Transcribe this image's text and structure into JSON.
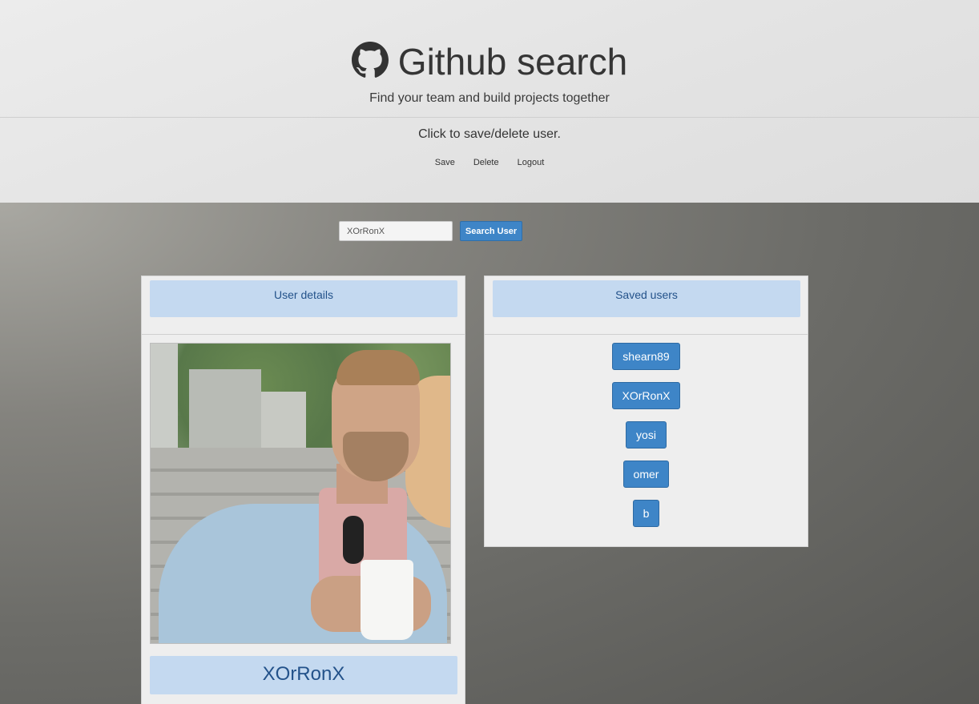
{
  "header": {
    "title": "Github search",
    "subtitle": "Find your team and build projects together",
    "instructions": "Click to save/delete user.",
    "actions": {
      "save": "Save",
      "delete": "Delete",
      "logout": "Logout"
    }
  },
  "search": {
    "value": "XOrRonX",
    "button_label": "Search User"
  },
  "user_details": {
    "heading": "User details",
    "username": "XOrRonX"
  },
  "saved_users": {
    "heading": "Saved users",
    "items": [
      "shearn89",
      "XOrRonX",
      "yosi",
      "omer",
      "b"
    ]
  },
  "colors": {
    "accent": "#3e85c7",
    "panel_heading": "#c4d9f0",
    "heading_text": "#23528a"
  }
}
